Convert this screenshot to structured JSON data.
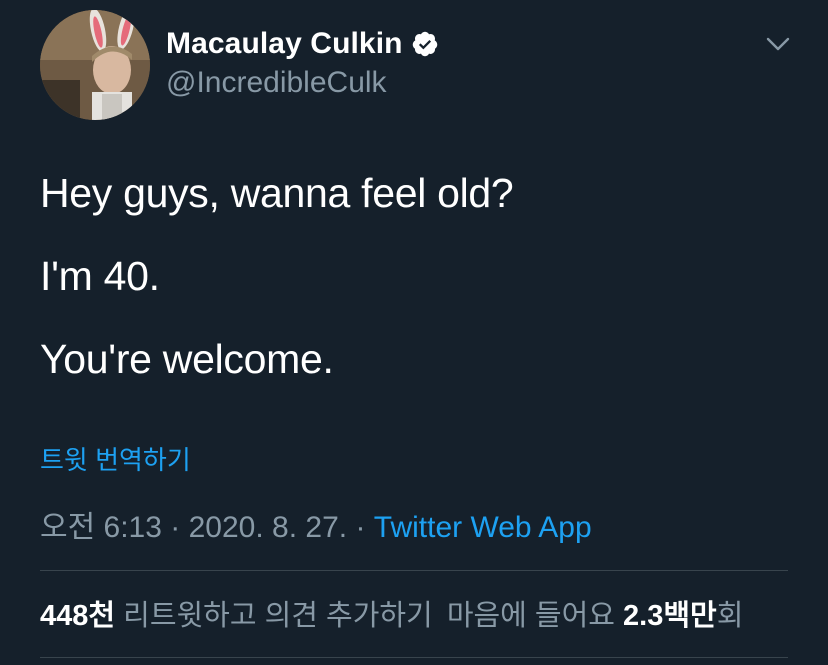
{
  "author": {
    "name": "Macaulay Culkin",
    "handle": "@IncredibleCulk",
    "verified_icon": "verified-badge-icon",
    "menu_icon": "chevron-down-icon"
  },
  "tweet": {
    "lines": [
      "Hey guys, wanna feel old?",
      "I'm 40.",
      "You're welcome."
    ],
    "translate_label": "트윗 번역하기"
  },
  "meta": {
    "time": "오전 6:13",
    "separator": "·",
    "date": "2020. 8. 27.",
    "source": "Twitter Web App"
  },
  "stats": {
    "retweets_count": "448천",
    "retweets_label": "리트윗하고 의견 추가하기",
    "likes_label": "마음에 들어요",
    "likes_count": "2.3백만",
    "likes_suffix": "회"
  },
  "colors": {
    "background": "#15202b",
    "primary_text": "#ffffff",
    "secondary_text": "#8899a6",
    "link": "#1da1f2",
    "divider": "#38444d"
  }
}
